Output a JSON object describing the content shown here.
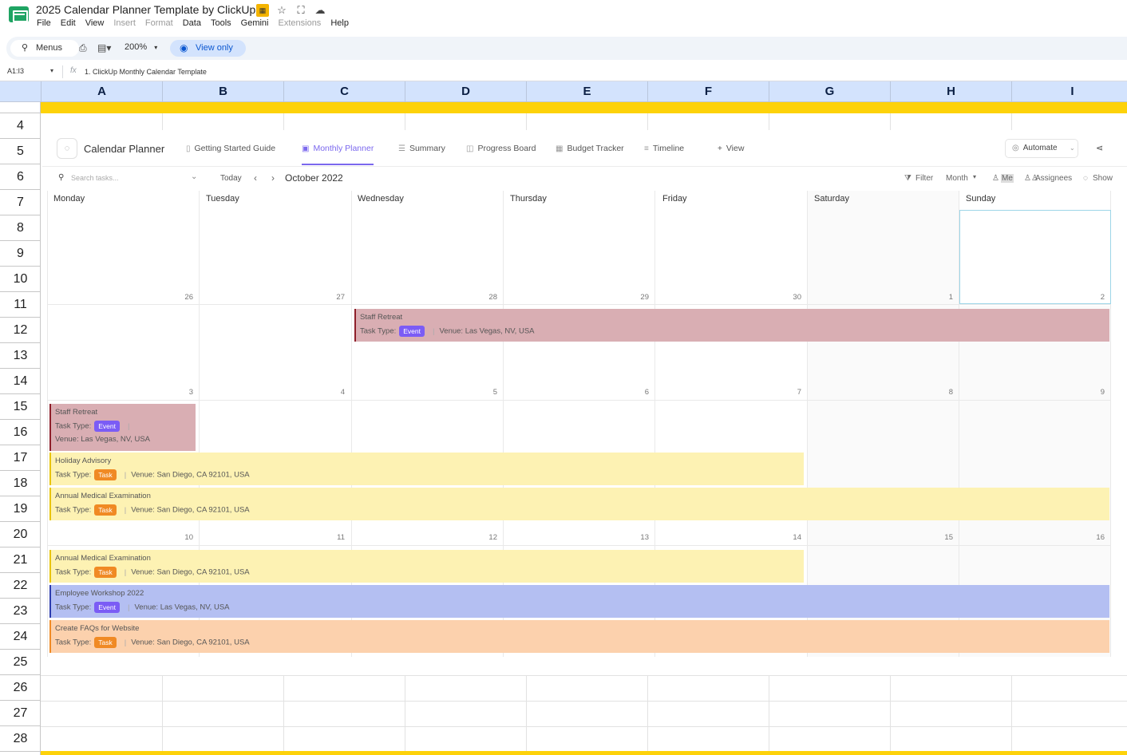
{
  "window": {
    "title": "2025 Calendar Planner Template by ClickUp",
    "menus": [
      {
        "label": "File",
        "enabled": true
      },
      {
        "label": "Edit",
        "enabled": true
      },
      {
        "label": "View",
        "enabled": true
      },
      {
        "label": "Insert",
        "enabled": false
      },
      {
        "label": "Format",
        "enabled": false
      },
      {
        "label": "Data",
        "enabled": true
      },
      {
        "label": "Tools",
        "enabled": true
      },
      {
        "label": "Gemini",
        "enabled": true
      },
      {
        "label": "Extensions",
        "enabled": false
      },
      {
        "label": "Help",
        "enabled": true
      }
    ]
  },
  "toolbar": {
    "menus_label": "Menus",
    "zoom": "200%",
    "view_only_label": "View only"
  },
  "formula_bar": {
    "name_box": "A1:I3",
    "fx": "fx",
    "content": "1. ClickUp Monthly Calendar Template"
  },
  "grid": {
    "columns": [
      "A",
      "B",
      "C",
      "D",
      "E",
      "F",
      "G",
      "H",
      "I"
    ],
    "rows": [
      "4",
      "5",
      "6",
      "7",
      "8",
      "9",
      "10",
      "11",
      "12",
      "13",
      "14",
      "15",
      "16",
      "17",
      "18",
      "19",
      "20",
      "21",
      "22",
      "23",
      "24",
      "25",
      "26",
      "27",
      "28"
    ]
  },
  "clickup": {
    "title": "Calendar Planner",
    "tabs": [
      {
        "label": "Getting Started Guide",
        "icon": "doc-icon"
      },
      {
        "label": "Monthly Planner",
        "icon": "calendar-icon",
        "active": true
      },
      {
        "label": "Summary",
        "icon": "list-icon"
      },
      {
        "label": "Progress Board",
        "icon": "board-icon"
      },
      {
        "label": "Budget Tracker",
        "icon": "table-icon"
      },
      {
        "label": "Timeline",
        "icon": "timeline-icon"
      },
      {
        "label": "View",
        "icon": "plus-icon"
      }
    ],
    "automate_label": "Automate",
    "search_placeholder": "Search tasks...",
    "today_label": "Today",
    "month_label": "October 2022",
    "filter_label": "Filter",
    "month_select": "Month",
    "me_label": "Me",
    "assignees_label": "Assignees",
    "show_label": "Show",
    "days": [
      "Monday",
      "Tuesday",
      "Wednesday",
      "Thursday",
      "Friday",
      "Saturday",
      "Sunday"
    ],
    "weeks": [
      [
        "26",
        "27",
        "28",
        "29",
        "30",
        "1",
        "2"
      ],
      [
        "3",
        "4",
        "5",
        "6",
        "7",
        "8",
        "9"
      ],
      [
        "10",
        "11",
        "12",
        "13",
        "14",
        "15",
        "16"
      ]
    ],
    "labels": {
      "task_type": "Task Type:",
      "venue": "Venue:"
    },
    "events": [
      {
        "title": "Staff Retreat",
        "type": "Event",
        "venue": "Las Vegas, NV, USA",
        "color": "red"
      },
      {
        "title": "Staff Retreat",
        "type": "Event",
        "venue": "Las Vegas, NV, USA",
        "color": "red"
      },
      {
        "title": "Holiday Advisory",
        "type": "Task",
        "venue": "San Diego, CA 92101, USA",
        "color": "yellow"
      },
      {
        "title": "Annual Medical Examination",
        "type": "Task",
        "venue": "San Diego, CA 92101, USA",
        "color": "yellow"
      },
      {
        "title": "Annual Medical Examination",
        "type": "Task",
        "venue": "San Diego, CA 92101, USA",
        "color": "yellow"
      },
      {
        "title": "Employee Workshop 2022",
        "type": "Event",
        "venue": "Las Vegas, NV, USA",
        "color": "blue"
      },
      {
        "title": "Create FAQs for Website",
        "type": "Task",
        "venue": "San Diego, CA 92101, USA",
        "color": "orange"
      }
    ]
  },
  "colors": {
    "accent": "#7b68ee",
    "header_band": "#fdd20a",
    "column_header_bg": "#d3e3fd"
  }
}
